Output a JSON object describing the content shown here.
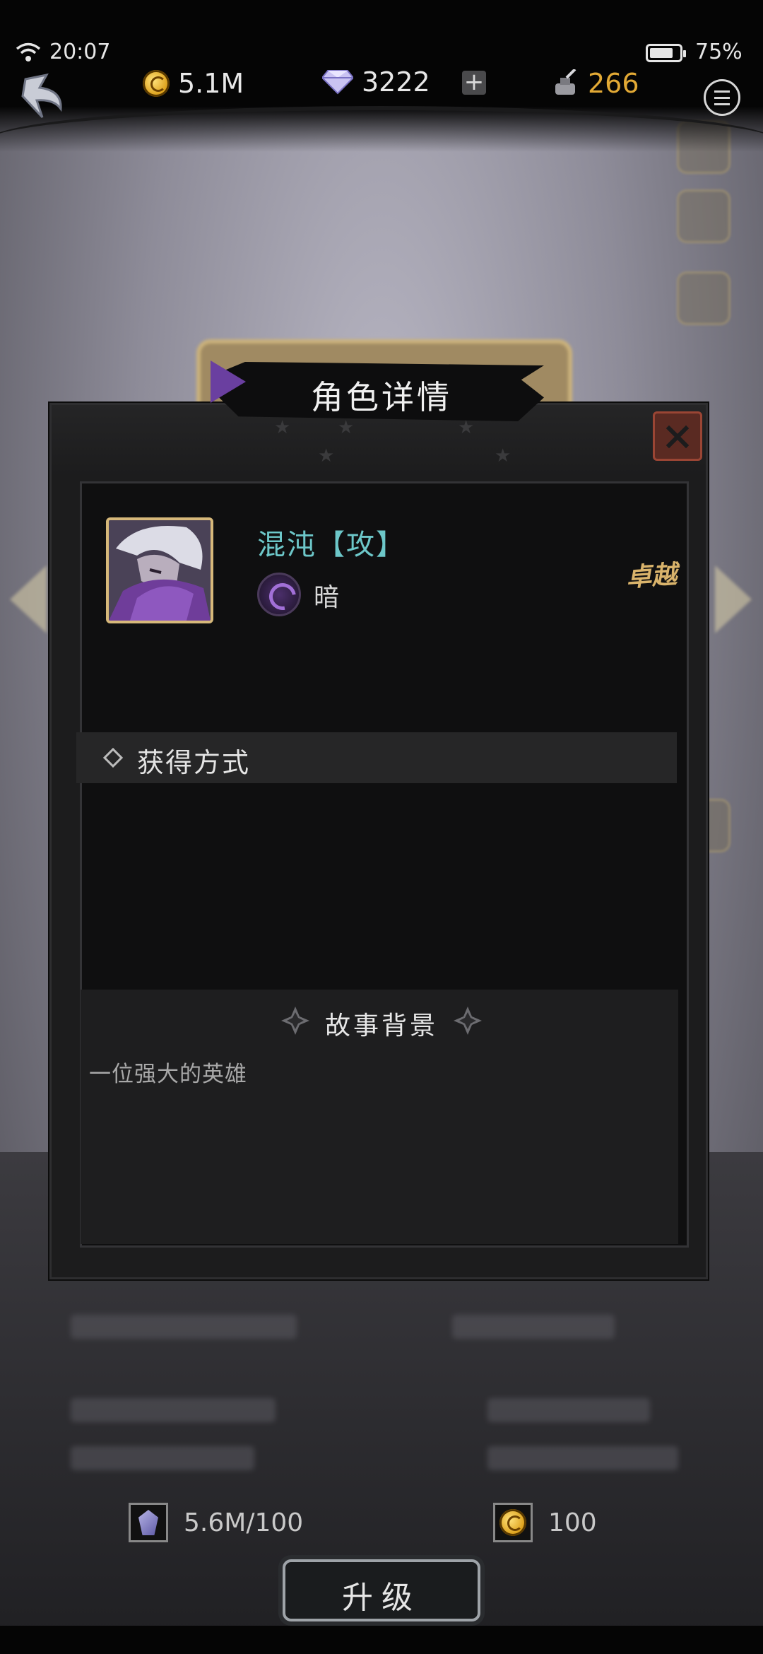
{
  "status_bar": {
    "time": "20:07",
    "battery": "75%"
  },
  "resources": {
    "gold": "5.1M",
    "gems": "3222",
    "ink": "266"
  },
  "dialog": {
    "title": "角色详情",
    "hero_name": "混沌【攻】",
    "element": "暗",
    "rarity": "卓越",
    "obtain_title": "获得方式",
    "story_title": "故事背景",
    "story_text": "一位强大的英雄"
  },
  "upgrade": {
    "crystal_cost": "5.6M/100",
    "gold_cost": "100",
    "button_label": "升级"
  },
  "colors": {
    "hero_name": "#6dc7c9",
    "rarity": "#d9b36b",
    "ink": "#e2a935",
    "accent_purple": "#6a3fa0"
  }
}
